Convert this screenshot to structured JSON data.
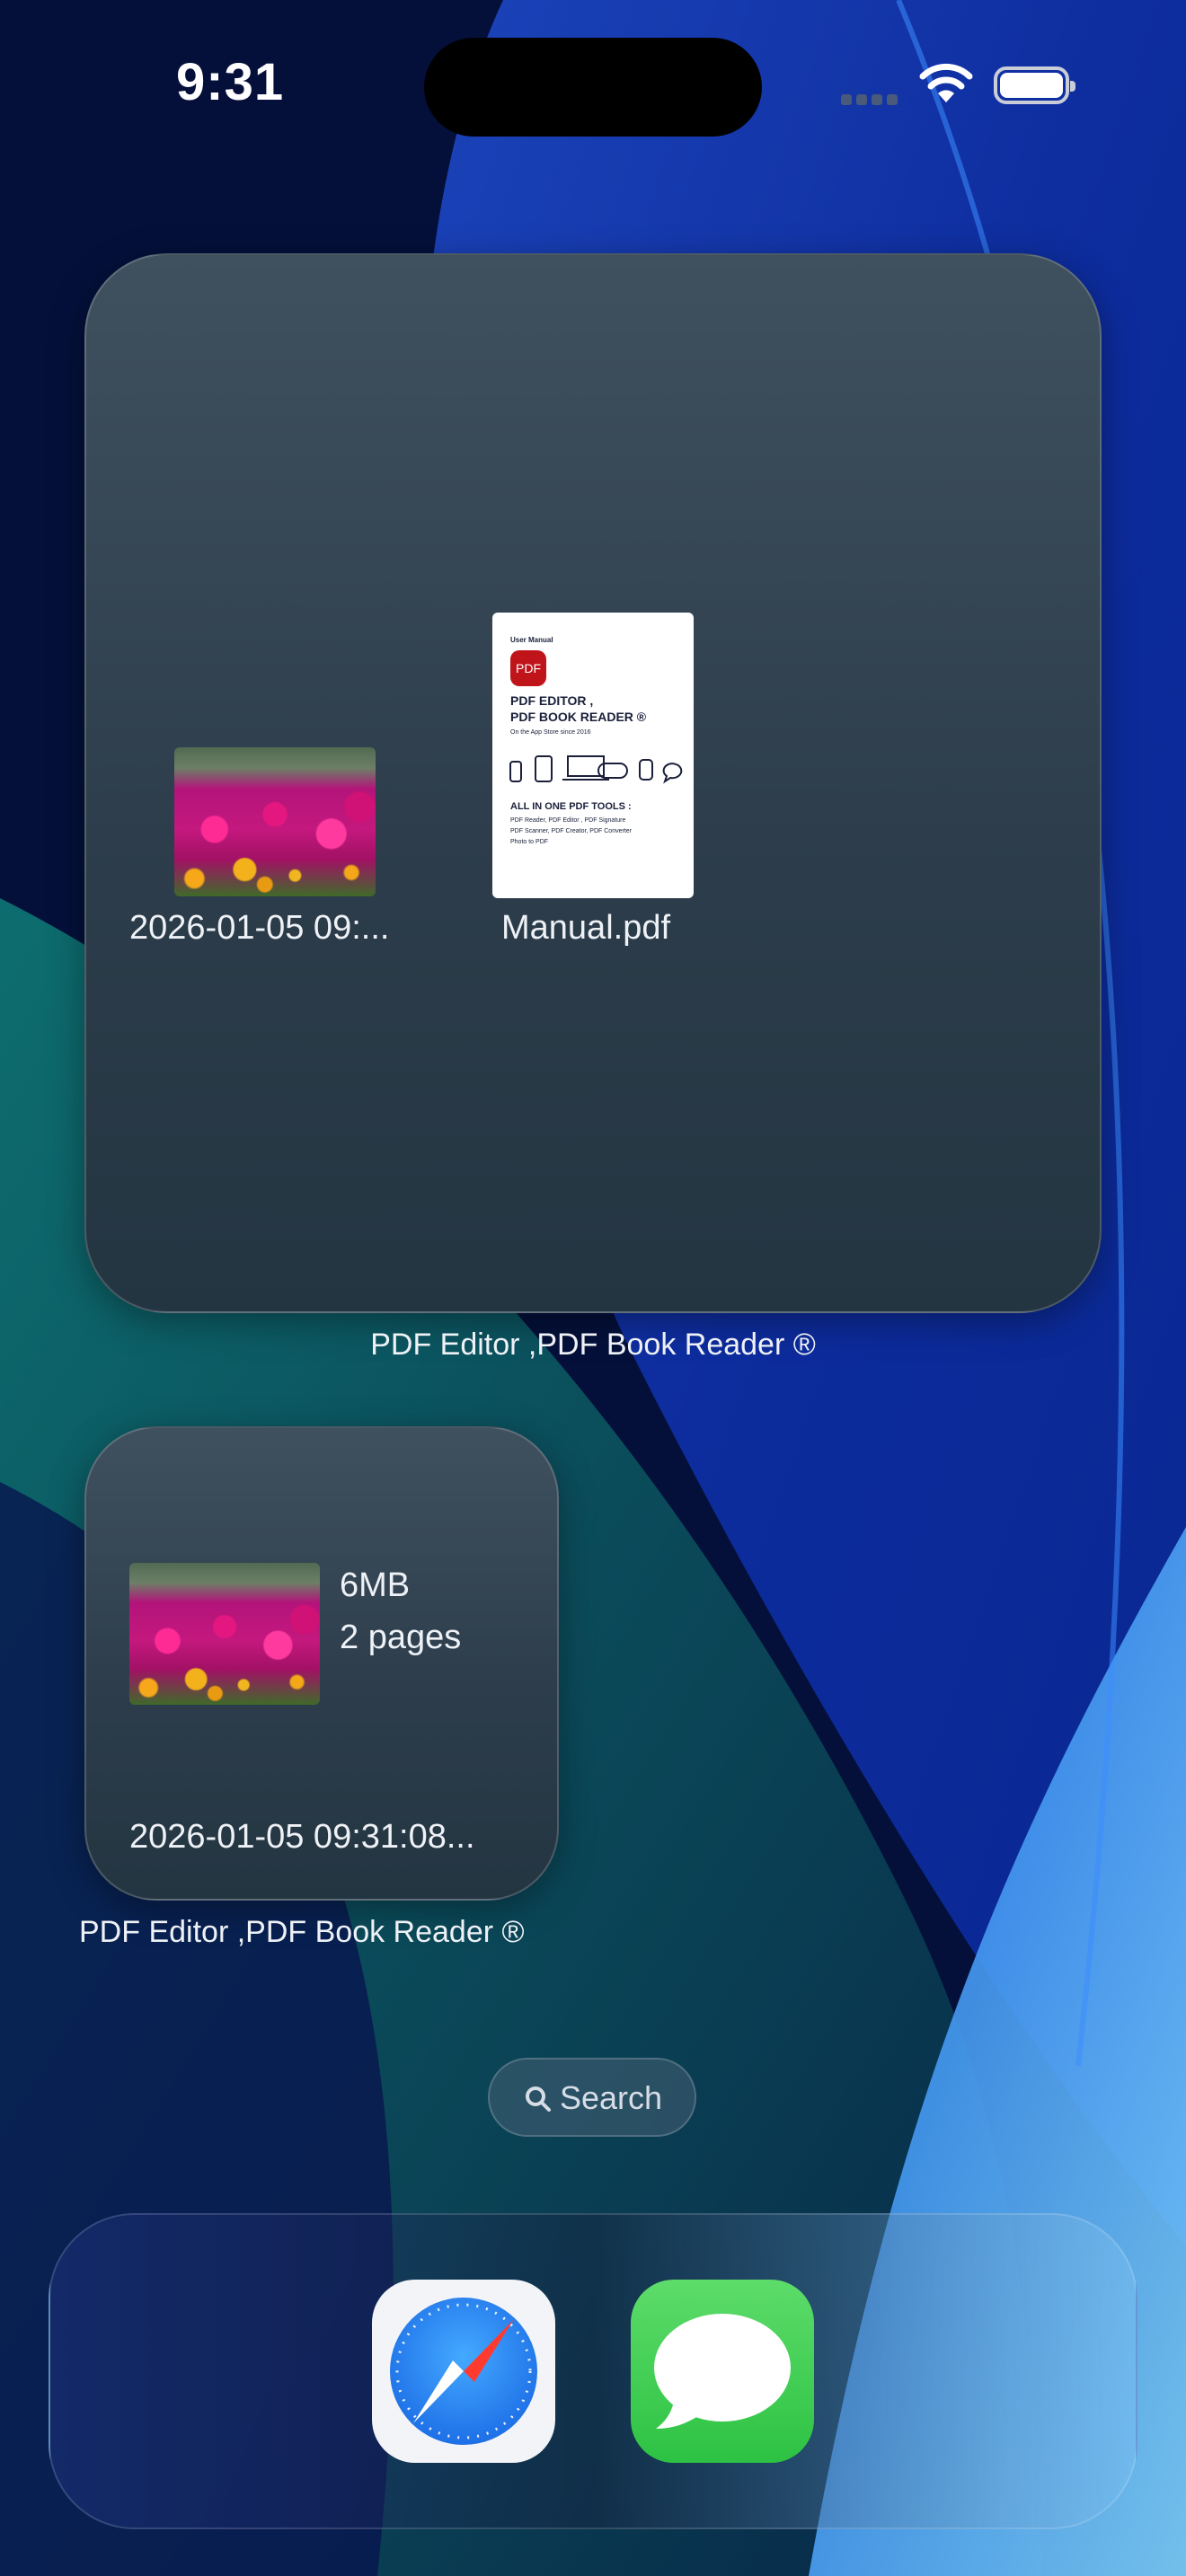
{
  "status_bar": {
    "time": "9:31"
  },
  "widgets": {
    "large": {
      "app_name": "PDF Editor ,PDF Book Reader ®",
      "files": [
        {
          "name": "2026-01-05 09:...",
          "thumb": "flowers-photo"
        },
        {
          "name": "Manual.pdf",
          "thumb": "pdf-manual-cover"
        }
      ],
      "manual_cover": {
        "small_title": "User Manual",
        "logo": "PDF",
        "title_line1": "PDF EDITOR ,",
        "title_line2": "PDF BOOK READER ®",
        "since": "On the App Store since 2016",
        "tools_title": "ALL IN ONE PDF TOOLS :",
        "tools_line1": "PDF Reader, PDF Editor , PDF Signature",
        "tools_line2": "PDF Scanner, PDF Creator, PDF Converter",
        "tools_line3": "Photo to PDF"
      }
    },
    "small": {
      "app_name": "PDF Editor ,PDF Book Reader ®",
      "size": "6MB",
      "pages": "2 pages",
      "filename": "2026-01-05 09:31:08..."
    }
  },
  "search": {
    "label": "Search",
    "icon": "magnifying-glass"
  },
  "dock": {
    "apps": [
      {
        "name": "Safari",
        "icon": "safari-icon"
      },
      {
        "name": "Messages",
        "icon": "messages-icon"
      }
    ]
  },
  "colors": {
    "widget_bg": "#33444f",
    "text": "#eef1f6"
  }
}
